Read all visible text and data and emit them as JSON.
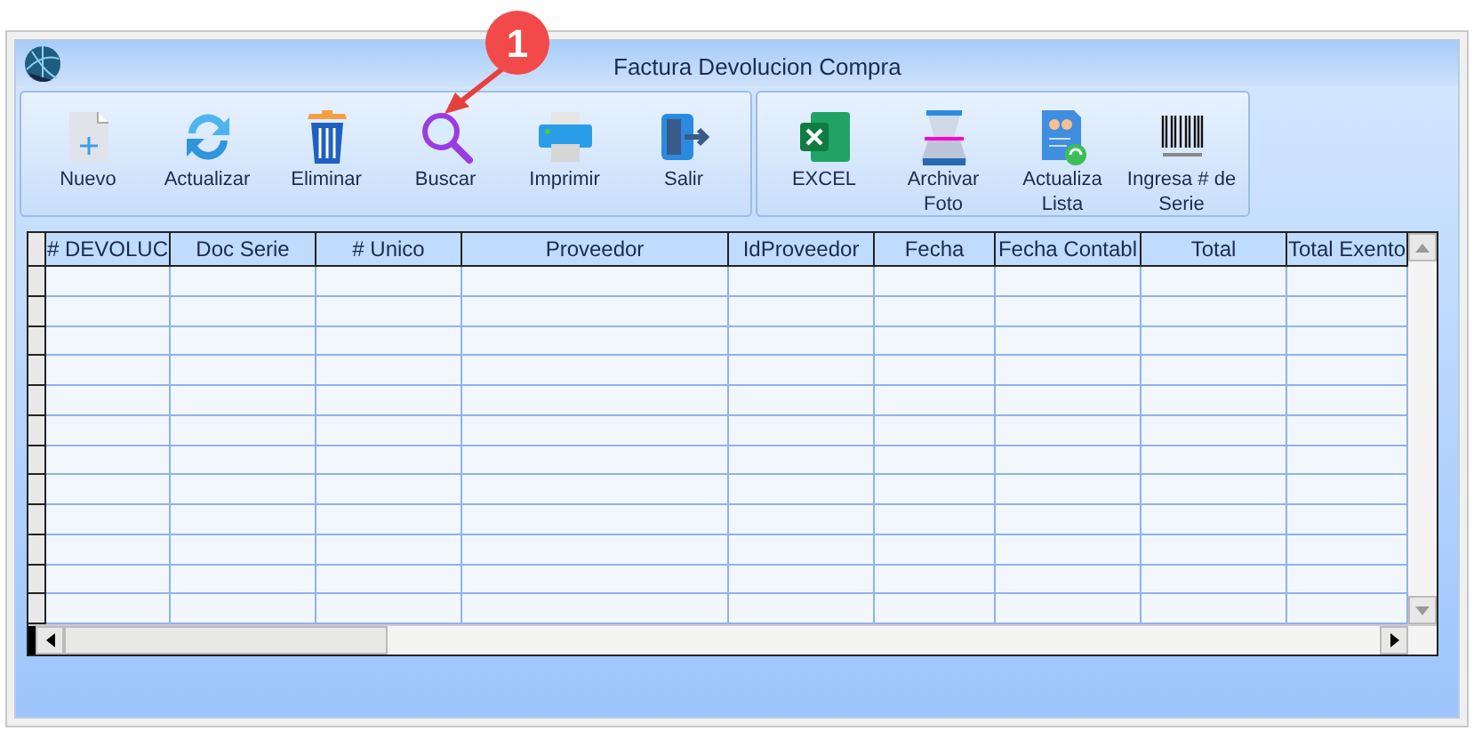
{
  "window": {
    "title": "Factura Devolucion Compra"
  },
  "callout": {
    "text": "1"
  },
  "toolbar": {
    "groups": [
      [
        {
          "label": "Nuevo",
          "kind": "new"
        },
        {
          "label": "Actualizar",
          "kind": "refresh"
        },
        {
          "label": "Eliminar",
          "kind": "delete"
        },
        {
          "label": "Buscar",
          "kind": "search"
        },
        {
          "label": "Imprimir",
          "kind": "print"
        },
        {
          "label": "Salir",
          "kind": "exit"
        }
      ],
      [
        {
          "label": "EXCEL",
          "kind": "excel"
        },
        {
          "label": "Archivar Foto",
          "kind": "scanner"
        },
        {
          "label": "Actualiza Lista",
          "kind": "list"
        },
        {
          "label": "Ingresa # de Serie",
          "kind": "barcode"
        }
      ]
    ]
  },
  "table": {
    "columns": [
      "# DEVOLUC",
      "Doc Serie",
      "# Unico",
      "Proveedor",
      "IdProveedor",
      "Fecha",
      "Fecha Contabl",
      "Total",
      "Total Exento"
    ]
  }
}
